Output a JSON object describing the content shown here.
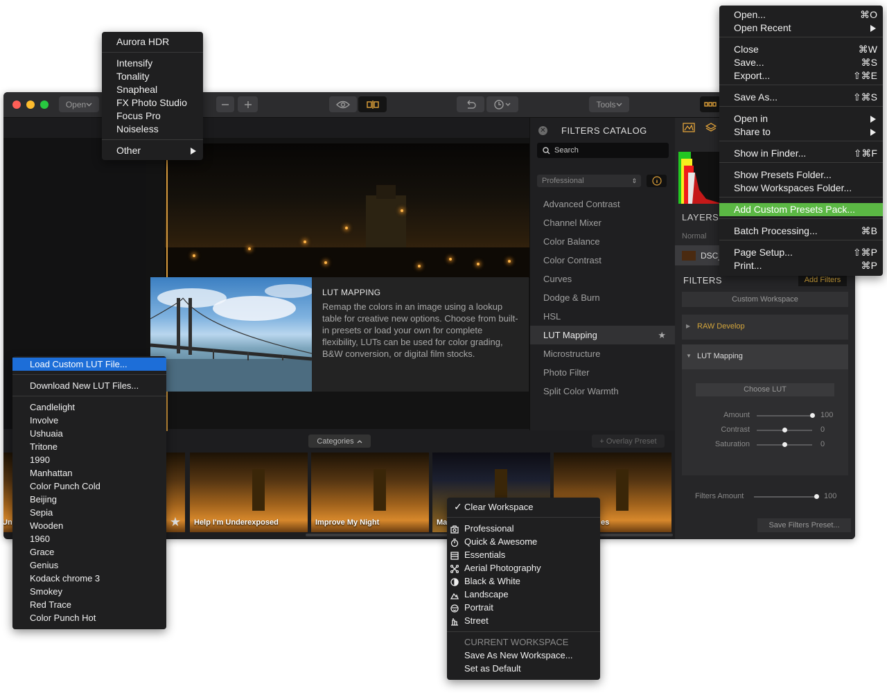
{
  "toolbar": {
    "open_label": "Open",
    "tools_label": "Tools"
  },
  "canvas": {
    "card_title": "LUT MAPPING",
    "card_description": "Remap the colors in an image using a lookup table for creative new options. Choose from built-in presets or load your own for complete flexibility, LUTs can be used for color grading, B&W conversion, or digital film stocks."
  },
  "presets": {
    "categories_label": "Categories",
    "overlay_label": "+ Overlay Preset",
    "items": [
      {
        "label": "Un"
      },
      {
        "label": "Help I'm Underexposed"
      },
      {
        "label": "Improve My Night"
      },
      {
        "label": "Ma"
      },
      {
        "label": "es"
      }
    ]
  },
  "catalog": {
    "title": "FILTERS CATALOG",
    "search_placeholder": "Search",
    "workspace": "Professional",
    "items": [
      "Advanced Contrast",
      "Channel Mixer",
      "Color Balance",
      "Color Contrast",
      "Curves",
      "Dodge & Burn",
      "HSL",
      "LUT Mapping",
      "Microstructure",
      "Photo Filter",
      "Split Color Warmth"
    ],
    "active_item": "LUT Mapping"
  },
  "right_panel": {
    "layers_label": "LAYERS",
    "blend_mode": "Normal",
    "layer_name": "DSC_",
    "filters_label": "FILTERS",
    "add_filters_label": "Add Filters",
    "workspace_label": "Custom Workspace",
    "raw_develop_label": "RAW Develop",
    "lut_mapping_label": "LUT Mapping",
    "choose_lut_label": "Choose LUT",
    "sliders": [
      {
        "label": "Amount",
        "value": 100
      },
      {
        "label": "Contrast",
        "value": 0
      },
      {
        "label": "Saturation",
        "value": 0
      }
    ],
    "filters_amount": {
      "label": "Filters Amount",
      "value": 100
    },
    "save_filters_label": "Save Filters Preset..."
  },
  "plugin_menu": {
    "items": [
      "Aurora HDR",
      "Intensify",
      "Tonality",
      "Snapheal",
      "FX Photo Studio",
      "Focus Pro",
      "Noiseless",
      "Other"
    ]
  },
  "file_menu": {
    "items": [
      {
        "label": "Open...",
        "shortcut": "⌘O"
      },
      {
        "label": "Open Recent",
        "shortcut": ""
      },
      {
        "label": "Close",
        "shortcut": "⌘W"
      },
      {
        "label": "Save...",
        "shortcut": "⌘S"
      },
      {
        "label": "Export...",
        "shortcut": "⇧⌘E"
      },
      {
        "label": "Save As...",
        "shortcut": "⇧⌘S"
      },
      {
        "label": "Open in",
        "shortcut": ""
      },
      {
        "label": "Share to",
        "shortcut": ""
      },
      {
        "label": "Show in Finder...",
        "shortcut": "⇧⌘F"
      },
      {
        "label": "Show Presets Folder...",
        "shortcut": ""
      },
      {
        "label": "Show Workspaces Folder...",
        "shortcut": ""
      },
      {
        "label": "Add Custom Presets Pack...",
        "shortcut": ""
      },
      {
        "label": "Batch Processing...",
        "shortcut": "⌘B"
      },
      {
        "label": "Page Setup...",
        "shortcut": "⇧⌘P"
      },
      {
        "label": "Print...",
        "shortcut": "⌘P"
      }
    ],
    "highlighted": "Add Custom Presets Pack...",
    "highlight_color": "#5bb844"
  },
  "lut_menu": {
    "items": [
      "Load Custom LUT File...",
      "Download New LUT Files...",
      "Candlelight",
      "Involve",
      "Ushuaia",
      "Tritone",
      "1990",
      "Manhattan",
      "Color Punch Cold",
      "Beijing",
      "Sepia",
      "Wooden",
      "1960",
      "Grace",
      "Genius",
      "Kodack chrome  3",
      "Smokey",
      "Red Trace",
      "Color Punch Hot"
    ],
    "highlighted": "Load Custom LUT File...",
    "highlight_color": "#1d6ed8"
  },
  "workspace_menu": {
    "checked_item": "Clear Workspace",
    "workspaces": [
      {
        "label": "Professional",
        "icon": "camera-icon"
      },
      {
        "label": "Quick & Awesome",
        "icon": "stopwatch-icon"
      },
      {
        "label": "Essentials",
        "icon": "list-icon"
      },
      {
        "label": "Aerial Photography",
        "icon": "drone-icon"
      },
      {
        "label": "Black & White",
        "icon": "contrast-icon"
      },
      {
        "label": "Landscape",
        "icon": "mountain-icon"
      },
      {
        "label": "Portrait",
        "icon": "face-icon"
      },
      {
        "label": "Street",
        "icon": "street-icon"
      }
    ],
    "section_header": "CURRENT WORKSPACE",
    "actions": [
      "Save As New Workspace...",
      "Set as Default"
    ]
  }
}
